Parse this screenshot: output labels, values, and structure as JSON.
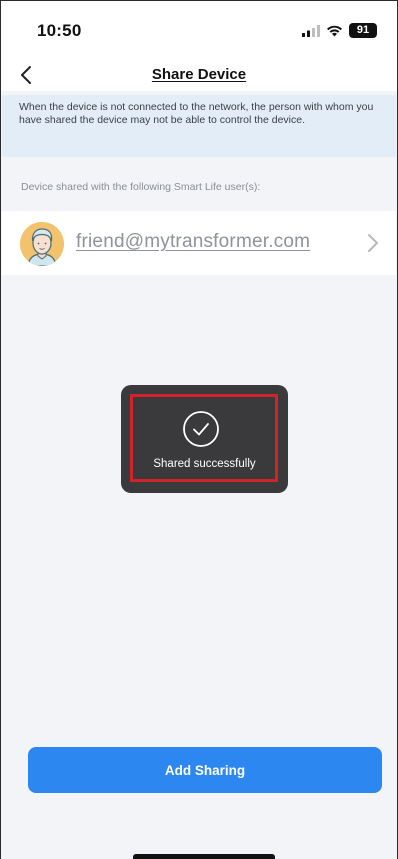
{
  "status_bar": {
    "time": "10:50",
    "battery": "91",
    "icons": [
      "signal-icon",
      "wifi-icon",
      "battery-icon"
    ]
  },
  "nav": {
    "back_icon": "chevron-left-icon",
    "title": "Share Device"
  },
  "notice": {
    "text": "When the device is not connected to the network, the person with whom you have shared the device may not be able to control the device."
  },
  "shared_list": {
    "label": "Device shared with the following Smart Life user(s):",
    "users": [
      {
        "email": "friend@mytransformer.com",
        "avatar_icon": "user-avatar-icon",
        "chevron_icon": "chevron-right-icon"
      }
    ]
  },
  "toast": {
    "icon": "check-circle-icon",
    "text": "Shared successfully"
  },
  "actions": {
    "add_sharing_label": "Add Sharing"
  },
  "colors": {
    "accent": "#2d87f0",
    "notice_bg": "#e3edf8",
    "highlight": "#d1232a",
    "toast_bg": "#3a3a3c",
    "page_bg": "#f3f4f8"
  }
}
